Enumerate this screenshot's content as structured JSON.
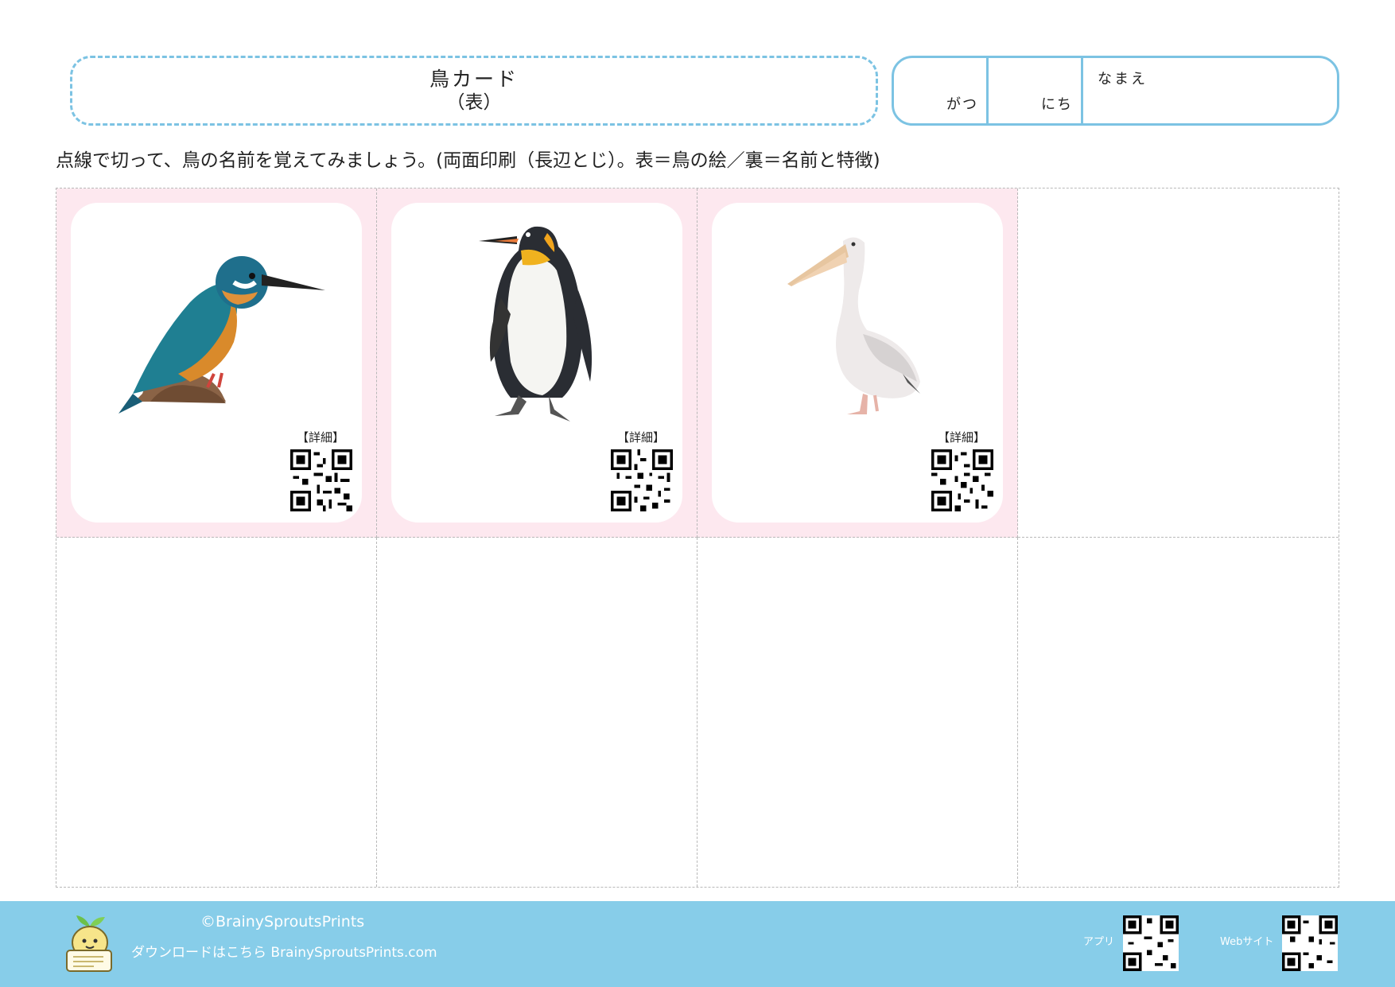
{
  "header": {
    "title": "鳥カード",
    "subtitle": "（表）",
    "month_unit": "がつ",
    "day_unit": "にち",
    "name_label": "なまえ"
  },
  "instruction": "点線で切って、鳥の名前を覚えてみましょう。(両面印刷（長辺とじ）。表＝鳥の絵／裏＝名前と特徴)",
  "cards": [
    {
      "icon": "kingfisher-illustration",
      "detail_label": "【詳細】"
    },
    {
      "icon": "penguin-illustration",
      "detail_label": "【詳細】"
    },
    {
      "icon": "pelican-illustration",
      "detail_label": "【詳細】"
    }
  ],
  "colors": {
    "accent": "#7cc3e3",
    "card_bg": "#fde8ef",
    "footer": "#87cde9"
  },
  "footer": {
    "copyright": "©BrainySproutsPrints",
    "download": "ダウンロードはこちら BrainySproutsPrints.com",
    "app_label": "アプリ",
    "web_label": "Webサイト"
  }
}
